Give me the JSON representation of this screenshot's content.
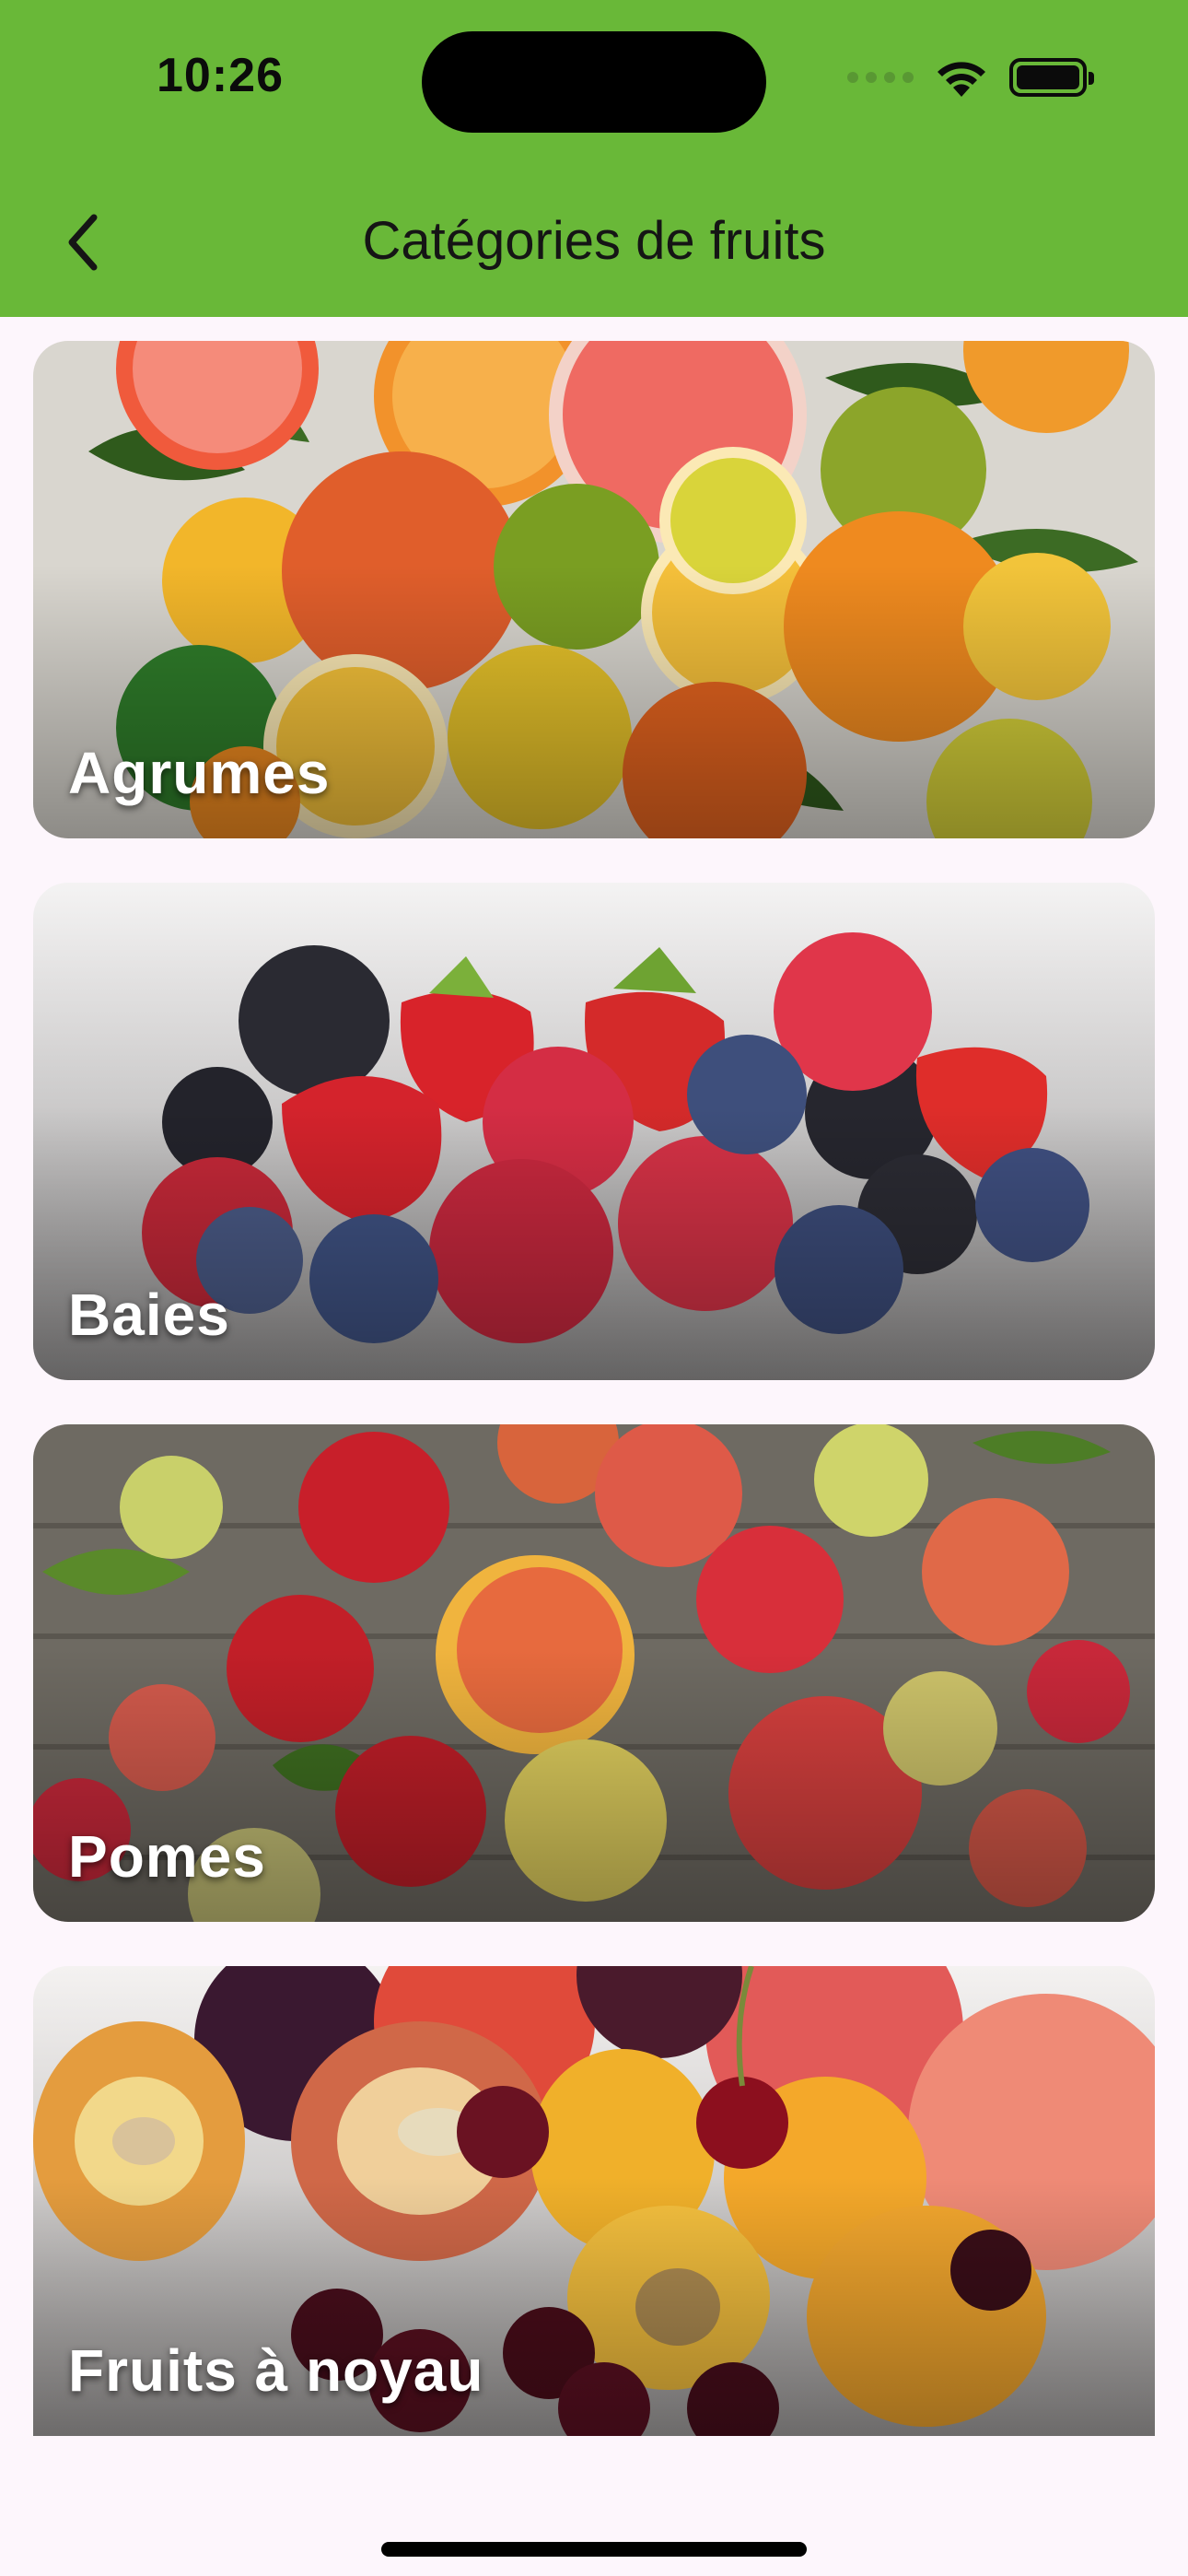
{
  "status_bar": {
    "time": "10:26"
  },
  "nav": {
    "title": "Catégories de fruits",
    "back_icon": "chevron-left-icon"
  },
  "colors": {
    "header": "#69b838",
    "background": "#fdf6fc",
    "label": "#ffffff"
  },
  "categories": [
    {
      "label": "Agrumes"
    },
    {
      "label": "Baies"
    },
    {
      "label": "Pomes"
    },
    {
      "label": "Fruits à noyau"
    }
  ]
}
